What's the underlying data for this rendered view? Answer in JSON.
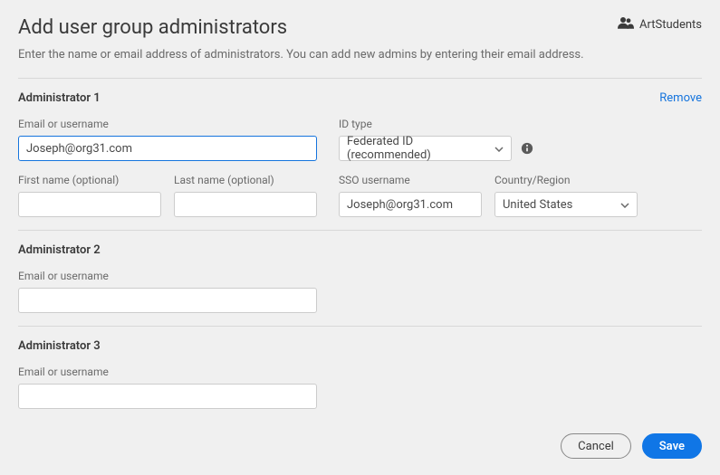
{
  "header": {
    "title": "Add user group administrators",
    "group_name": "ArtStudents",
    "intro": "Enter the name or email address of administrators. You can add new admins by entering their email address."
  },
  "labels": {
    "email_or_username": "Email or username",
    "id_type": "ID type",
    "first_name": "First name (optional)",
    "last_name": "Last name (optional)",
    "sso_username": "SSO username",
    "country_region": "Country/Region"
  },
  "admins": [
    {
      "title": "Administrator 1",
      "remove": "Remove",
      "email_value": "Joseph@org31.com",
      "id_type_value": "Federated ID (recommended)",
      "first_name_value": "",
      "last_name_value": "",
      "sso_value": "Joseph@org31.com",
      "country_value": "United States"
    },
    {
      "title": "Administrator 2",
      "email_value": ""
    },
    {
      "title": "Administrator 3",
      "email_value": ""
    }
  ],
  "footer": {
    "cancel": "Cancel",
    "save": "Save"
  }
}
